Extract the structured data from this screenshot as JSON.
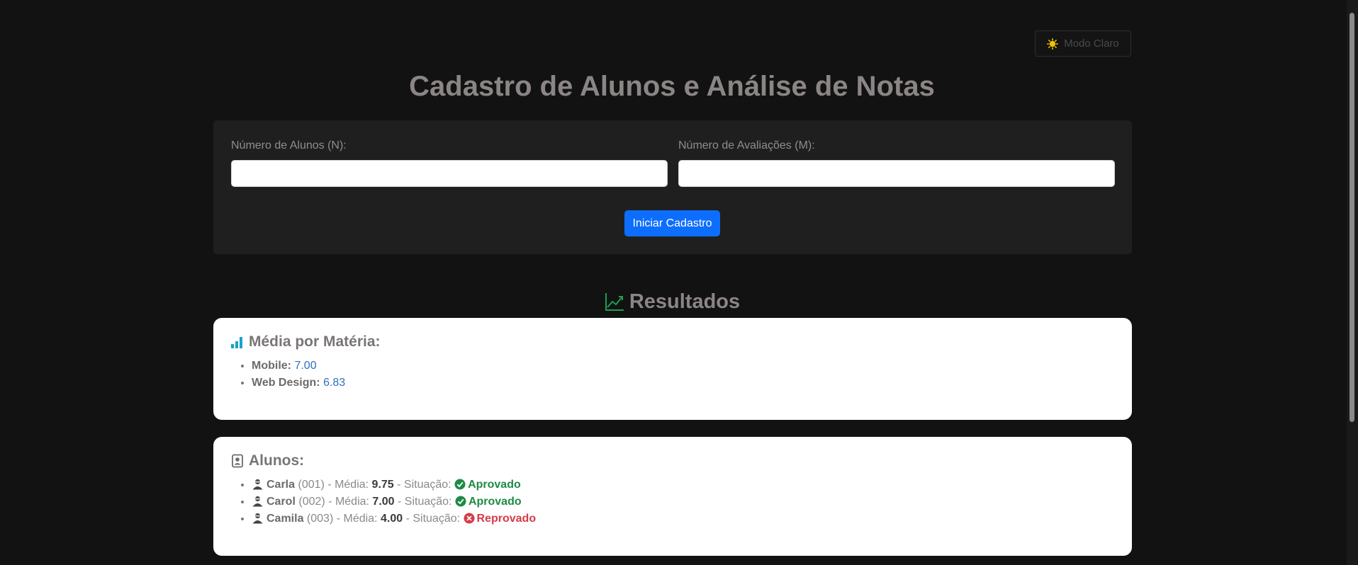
{
  "theme_toggle": {
    "label": "Modo Claro",
    "icon": "sun-icon"
  },
  "title": "Cadastro de Alunos e Análise de Notas",
  "form": {
    "students_label": "Número de Alunos (N):",
    "students_value": "",
    "evaluations_label": "Número de Avaliações (M):",
    "evaluations_value": "",
    "start_button": "Iniciar Cadastro"
  },
  "results": {
    "heading": "Resultados",
    "icon": "line-chart-icon"
  },
  "subject_means": {
    "title": "Média por Matéria:",
    "icon": "bar-chart-icon",
    "items": [
      {
        "subject": "Mobile:",
        "value": "7.00"
      },
      {
        "subject": "Web Design:",
        "value": "6.83"
      }
    ]
  },
  "students": {
    "title": "Alunos:",
    "icon": "id-badge-icon",
    "media_label": "Média:",
    "status_label": "Situação:",
    "items": [
      {
        "name": "Carla",
        "id": "(001)",
        "mean": "9.75",
        "status": "Aprovado",
        "status_color": "#1f8a45"
      },
      {
        "name": "Carol",
        "id": "(002)",
        "mean": "7.00",
        "status": "Aprovado",
        "status_color": "#1f8a45"
      },
      {
        "name": "Camila",
        "id": "(003)",
        "mean": "4.00",
        "status": "Reprovado",
        "status_color": "#d63a47"
      }
    ]
  }
}
